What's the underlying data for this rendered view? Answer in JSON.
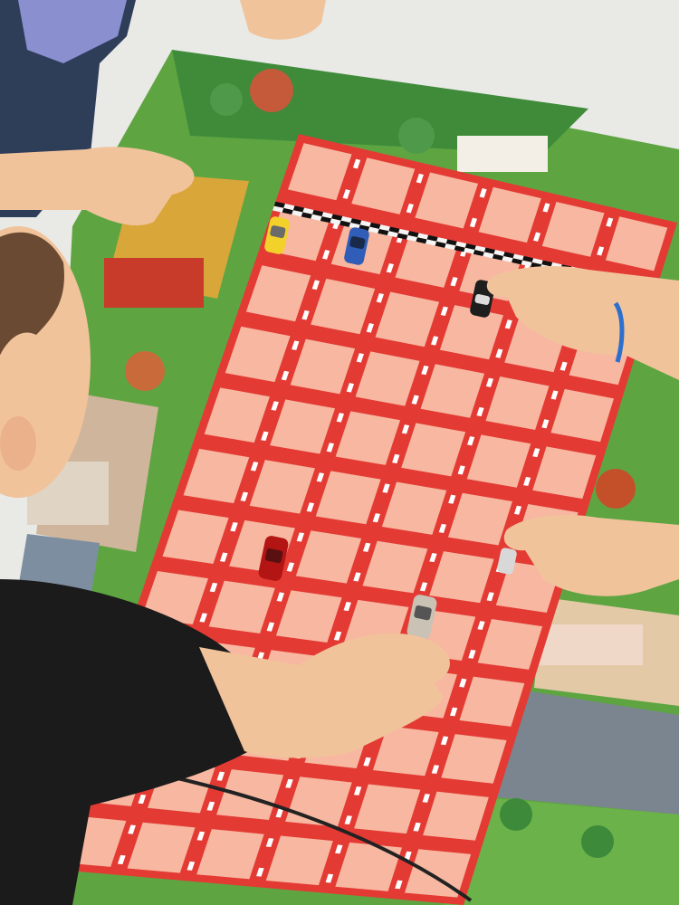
{
  "scene": {
    "description_visible_text": "",
    "colors": {
      "table": "#e9e9e6",
      "board_border": "#2f7a3a",
      "track_red": "#e33a34",
      "lane_pink": "#f7b7a0",
      "dash_white": "#ffffff",
      "checker_dark": "#111111",
      "checker_light": "#f5f5f5",
      "grass": "#5ea542",
      "field_yellow": "#d9a63a",
      "skin": "#f1c39b",
      "shirt": "#1b1b1b",
      "hair": "#6a4a33"
    },
    "cars": [
      {
        "name": "yellow-car",
        "color": "#f2d12b"
      },
      {
        "name": "blue-car",
        "color": "#2f5db8"
      },
      {
        "name": "black-car",
        "color": "#1e1e1e"
      },
      {
        "name": "red-car",
        "color": "#b31414"
      },
      {
        "name": "silver-car-left",
        "color": "#c9c2b5"
      },
      {
        "name": "silver-car-right",
        "color": "#d8d8d8"
      }
    ]
  }
}
